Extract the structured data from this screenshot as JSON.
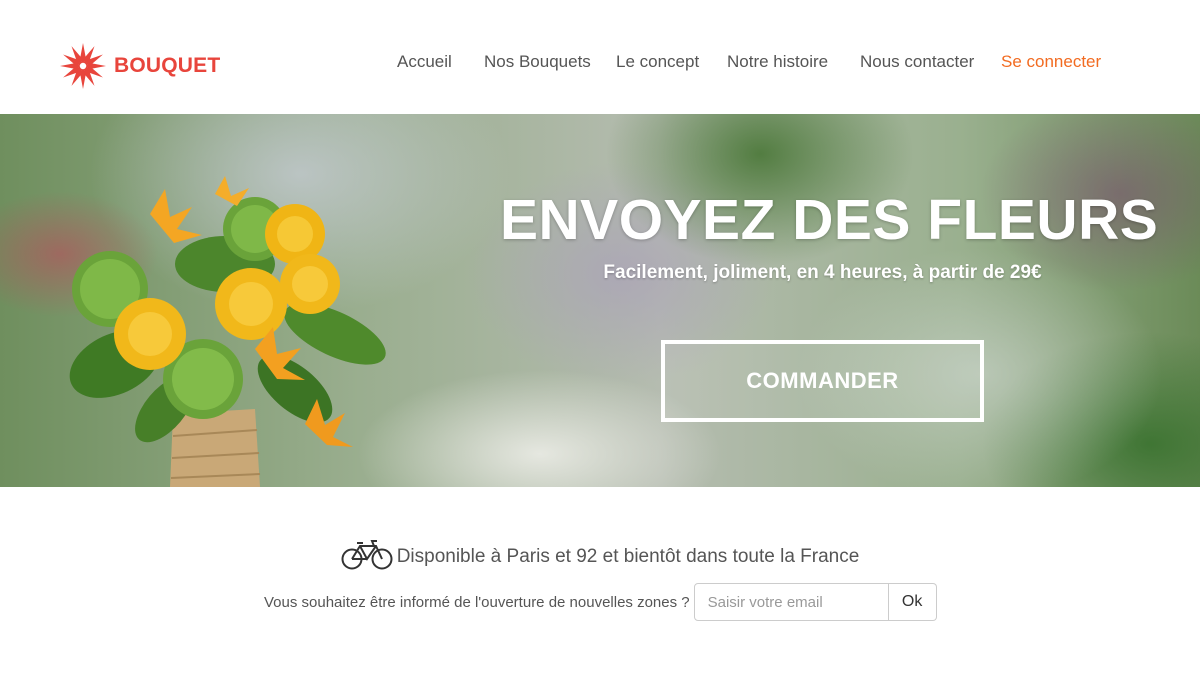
{
  "header": {
    "brand": "BOUQUET",
    "logo_icon": "flower-burst-icon",
    "nav": [
      {
        "label": "Accueil"
      },
      {
        "label": "Nos Bouquets"
      },
      {
        "label": "Le concept"
      },
      {
        "label": "Notre histoire"
      },
      {
        "label": "Nous contacter"
      },
      {
        "label": "Se connecter"
      }
    ]
  },
  "hero": {
    "title": "ENVOYEZ DES FLEURS",
    "subtitle": "Facilement, joliment, en 4 heures, à partir de 29€",
    "cta_label": "COMMANDER"
  },
  "availability": {
    "icon": "bicycle-icon",
    "text": "Disponible à Paris et 92 et bientôt dans toute la France"
  },
  "notify": {
    "question": "Vous souhaitez être informé de l'ouverture de nouvelles zones ?",
    "email_placeholder": "Saisir votre email",
    "email_value": "",
    "submit_label": "Ok"
  },
  "colors": {
    "brand_red": "#e8453c",
    "accent_orange": "#f26b21",
    "nav_text": "#555555",
    "hero_text": "#ffffff"
  }
}
